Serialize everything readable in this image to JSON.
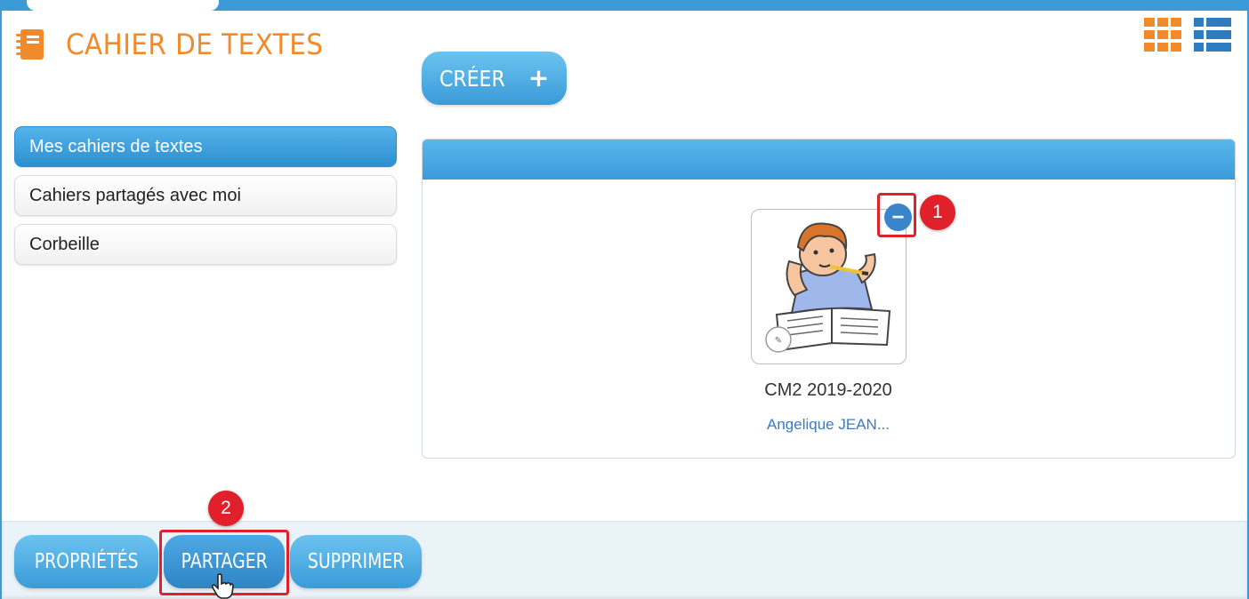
{
  "app": {
    "title": "CAHIER DE TEXTES",
    "accent_color": "#f18a2b",
    "brand_color": "#3a9bd8",
    "title_icon": "notebook-icon"
  },
  "view_toggles": {
    "grid_icon": "grid-view-icon",
    "list_icon": "list-view-icon"
  },
  "toolbar": {
    "create_label": "CRÉER",
    "create_icon": "plus-icon"
  },
  "sidebar": {
    "items": [
      {
        "label": "Mes cahiers de textes",
        "active": true
      },
      {
        "label": "Cahiers partagés avec moi",
        "active": false
      },
      {
        "label": "Corbeille",
        "active": false
      }
    ]
  },
  "main": {
    "cards": [
      {
        "name": "CM2 2019-2020",
        "owner": "Angelique JEAN...",
        "selected": true,
        "thumbnail_icon": "student-writing-illustration",
        "remove_icon": "minus-icon"
      }
    ]
  },
  "annotations": {
    "step_1": "1",
    "step_2": "2",
    "highlight_color": "#e0202a"
  },
  "actions": {
    "properties_label": "PROPRIÉTÉS",
    "share_label": "PARTAGER",
    "delete_label": "SUPPRIMER"
  }
}
